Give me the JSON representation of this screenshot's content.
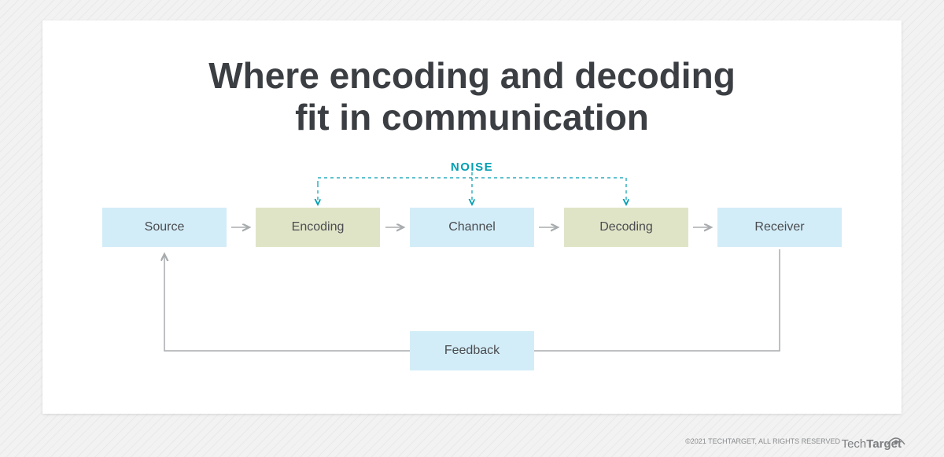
{
  "title": "Where encoding and decoding\nfit in communication",
  "noise": "NOISE",
  "boxes": {
    "source": "Source",
    "encoding": "Encoding",
    "channel": "Channel",
    "decoding": "Decoding",
    "receiver": "Receiver",
    "feedback": "Feedback"
  },
  "footer": {
    "copyright": "©2021 TECHTARGET, ALL RIGHTS RESERVED",
    "brand1": "Tech",
    "brand2": "Target"
  }
}
